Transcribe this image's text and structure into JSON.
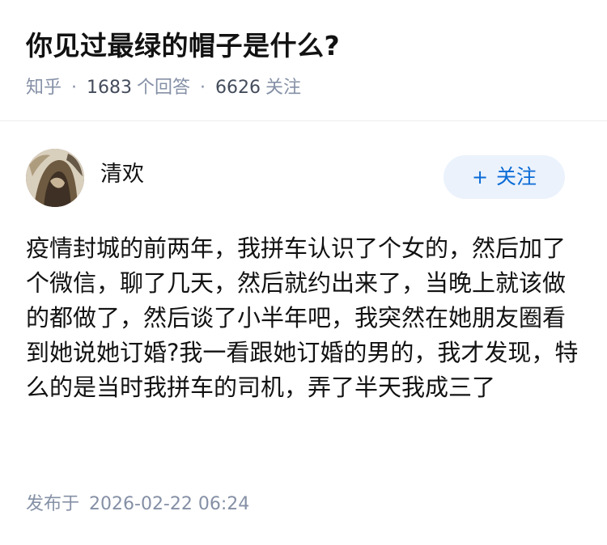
{
  "question": {
    "title": "你见过最绿的帽子是什么?",
    "source": "知乎",
    "separator": "·",
    "answer_count": "1683",
    "answer_label": "个回答",
    "follower_count": "6626",
    "follower_label": "关注"
  },
  "answer": {
    "author": {
      "name": "清欢",
      "avatar_icon": "avatar-photo"
    },
    "follow_button": {
      "icon": "+",
      "label": "关注"
    },
    "body": "疫情封城的前两年，我拼车认识了个女的，然后加了个微信，聊了几天，然后就约出来了，当晚上就该做的都做了，然后谈了小半年吧，我突然在她朋友圈看到她说她订婚?我一看跟她订婚的男的，我才发现，特么的是当时我拼车的司机，弄了半天我成三了",
    "published_label": "发布于",
    "published_time": "2026-02-22 06:24"
  },
  "colors": {
    "text": "#121212",
    "meta": "#8590a6",
    "accent": "#0b6bd6",
    "button_bg": "#ebf2fc",
    "divider": "#ececec"
  }
}
